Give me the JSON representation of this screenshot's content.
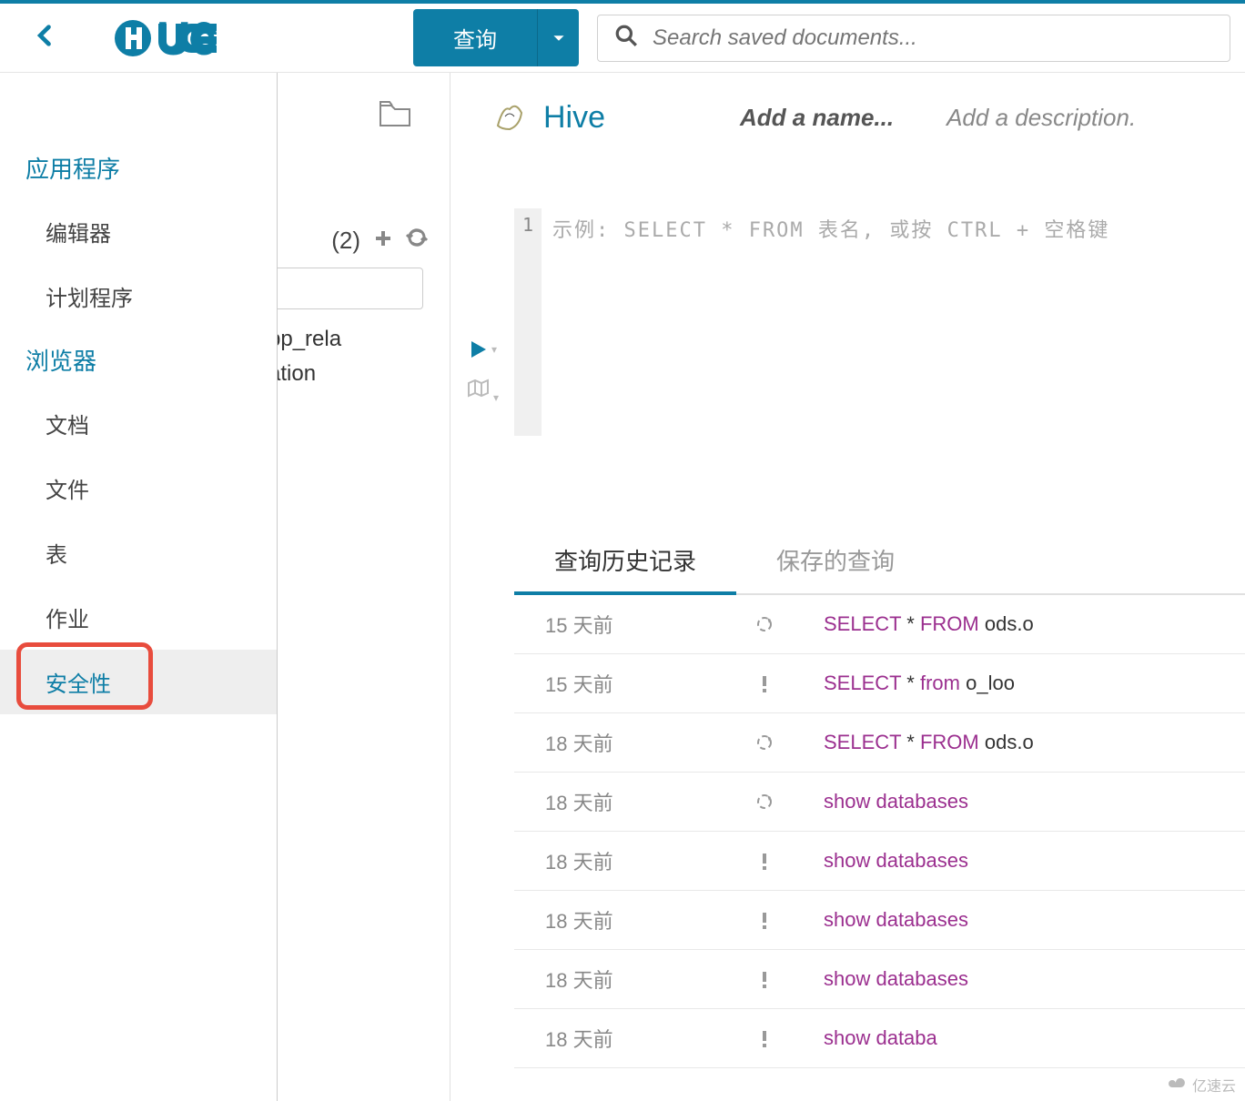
{
  "header": {
    "query_label": "查询",
    "search_placeholder": "Search saved documents..."
  },
  "sidebar": {
    "sections": [
      {
        "title": "应用程序",
        "items": [
          "编辑器",
          "计划程序"
        ]
      },
      {
        "title": "浏览器",
        "items": [
          "文档",
          "文件",
          "表",
          "作业",
          "安全性"
        ]
      }
    ],
    "active_item": "安全性"
  },
  "mid": {
    "count_label": "(2)",
    "partial_text_1": "pp_rela",
    "partial_text_2": "ation"
  },
  "editor": {
    "type": "Hive",
    "name_placeholder": "Add a name...",
    "desc_placeholder": "Add a description.",
    "line_number": "1",
    "code_placeholder": "示例: SELECT * FROM 表名, 或按 CTRL + 空格键"
  },
  "tabs": {
    "history": "查询历史记录",
    "saved": "保存的查询"
  },
  "history": [
    {
      "when": "15 天前",
      "status": "spin",
      "sql": [
        {
          "t": "SELECT",
          "k": true
        },
        {
          "t": " * ",
          "k": false
        },
        {
          "t": "FROM",
          "k": true
        },
        {
          "t": " ods.o",
          "k": false
        }
      ]
    },
    {
      "when": "15 天前",
      "status": "warn",
      "sql": [
        {
          "t": "SELECT",
          "k": true
        },
        {
          "t": " * ",
          "k": false
        },
        {
          "t": "from",
          "k": true
        },
        {
          "t": " o_loo",
          "k": false
        }
      ]
    },
    {
      "when": "18 天前",
      "status": "spin",
      "sql": [
        {
          "t": "SELECT",
          "k": true
        },
        {
          "t": " * ",
          "k": false
        },
        {
          "t": "FROM",
          "k": true
        },
        {
          "t": " ods.o",
          "k": false
        }
      ]
    },
    {
      "when": "18 天前",
      "status": "spin",
      "sql": [
        {
          "t": "show databases",
          "k": true
        }
      ]
    },
    {
      "when": "18 天前",
      "status": "warn",
      "sql": [
        {
          "t": "show databases",
          "k": true
        }
      ]
    },
    {
      "when": "18 天前",
      "status": "warn",
      "sql": [
        {
          "t": "show databases",
          "k": true
        }
      ]
    },
    {
      "when": "18 天前",
      "status": "warn",
      "sql": [
        {
          "t": "show databases",
          "k": true
        }
      ]
    },
    {
      "when": "18 天前",
      "status": "warn",
      "sql": [
        {
          "t": "show databa",
          "k": true
        }
      ]
    }
  ],
  "watermark": "亿速云"
}
